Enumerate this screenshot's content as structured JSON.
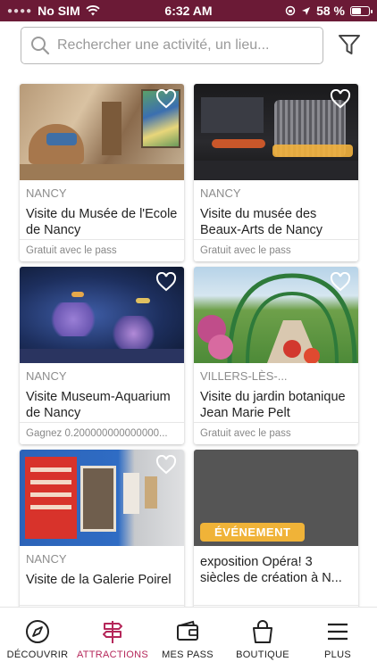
{
  "status": {
    "carrier": "No SIM",
    "time": "6:32 AM",
    "battery": "58 %",
    "battery_level": 0.58
  },
  "search": {
    "placeholder": "Rechercher une activité, un lieu..."
  },
  "cards": [
    {
      "place": "NANCY",
      "title": "Visite du Musée de l'Ecole de Nancy",
      "subtitle": "Gratuit avec le pass"
    },
    {
      "place": "NANCY",
      "title": "Visite du musée des Beaux-Arts de Nancy",
      "subtitle": "Gratuit avec le pass"
    },
    {
      "place": "NANCY",
      "title": "Visite  Museum-Aquarium de Nancy",
      "subtitle": "Gagnez 0.200000000000000..."
    },
    {
      "place": "VILLERS-LÈS-...",
      "title": "Visite du jardin botanique Jean Marie Pelt",
      "subtitle": "Gratuit avec le pass"
    },
    {
      "place": "NANCY",
      "title": "Visite de la Galerie Poirel",
      "subtitle": ""
    },
    {
      "badge": "ÉVÉNEMENT",
      "title": "exposition Opéra! 3 siècles de création à N...",
      "subtitle": ""
    }
  ],
  "tabs": [
    {
      "label": "DÉCOUVRIR",
      "icon": "compass-icon"
    },
    {
      "label": "ATTRACTIONS",
      "icon": "signpost-icon"
    },
    {
      "label": "MES PASS",
      "icon": "wallet-icon"
    },
    {
      "label": "BOUTIQUE",
      "icon": "shopping-bag-icon"
    },
    {
      "label": "PLUS",
      "icon": "menu-icon"
    }
  ],
  "colors": {
    "status_bar": "#6b1a36",
    "active_tab": "#b5275a",
    "event_badge": "#f0b338"
  }
}
